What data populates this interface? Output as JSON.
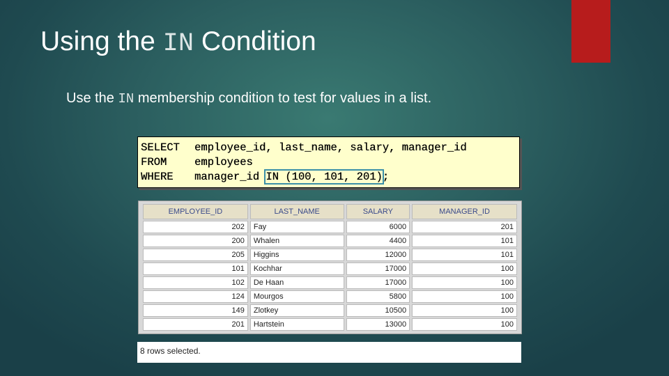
{
  "slide": {
    "title_before": "Using the ",
    "title_code": "IN",
    "title_after": " Condition",
    "subtitle_before": "Use the ",
    "subtitle_code": "IN",
    "subtitle_after": " membership condition to test for values in a list.",
    "accent_color": "#b71c1c"
  },
  "sql": {
    "line1_kw": "SELECT",
    "line1_rest": "employee_id, last_name, salary, manager_id",
    "line2_kw": "FROM",
    "line2_rest": "employees",
    "line3_kw": "WHERE",
    "line3_pre": "manager_id ",
    "line3_highlight": "IN (100, 101, 201)",
    "line3_post": ";"
  },
  "table": {
    "headers": [
      "EMPLOYEE_ID",
      "LAST_NAME",
      "SALARY",
      "MANAGER_ID"
    ],
    "rows": [
      [
        "202",
        "Fay",
        "6000",
        "201"
      ],
      [
        "200",
        "Whalen",
        "4400",
        "101"
      ],
      [
        "205",
        "Higgins",
        "12000",
        "101"
      ],
      [
        "101",
        "Kochhar",
        "17000",
        "100"
      ],
      [
        "102",
        "De Haan",
        "17000",
        "100"
      ],
      [
        "124",
        "Mourgos",
        "5800",
        "100"
      ],
      [
        "149",
        "Zlotkey",
        "10500",
        "100"
      ],
      [
        "201",
        "Hartstein",
        "13000",
        "100"
      ]
    ]
  },
  "footer": {
    "note": "8 rows selected."
  }
}
